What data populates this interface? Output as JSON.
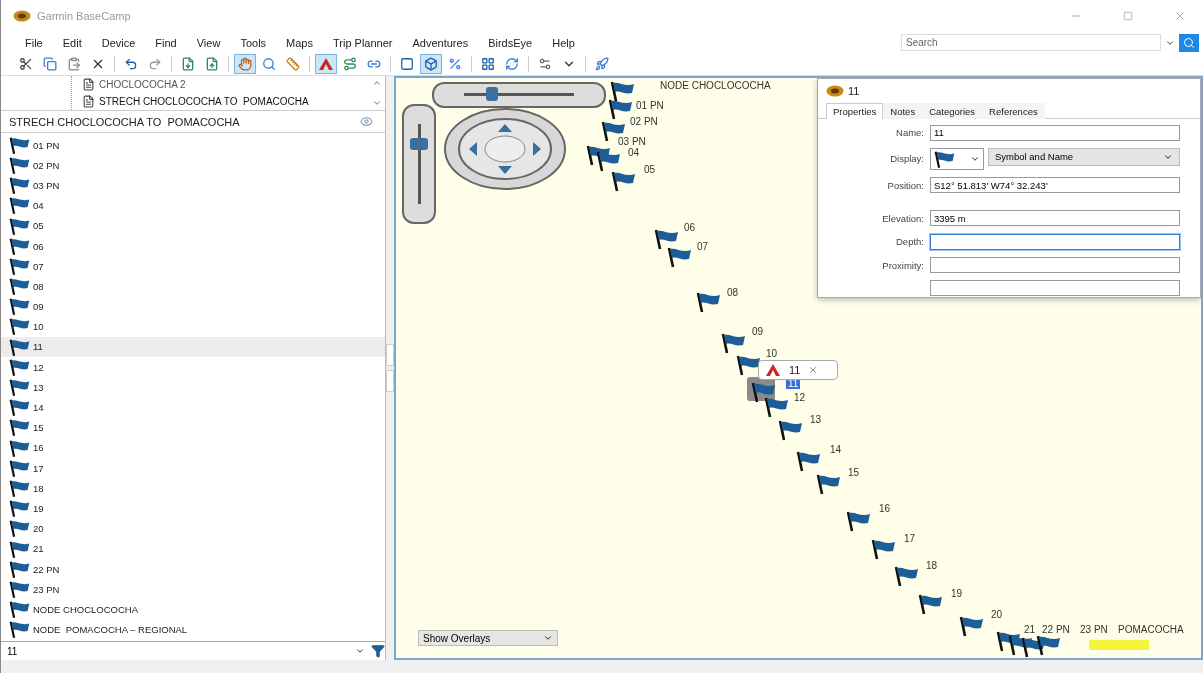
{
  "window": {
    "title": "Garmin BaseCamp"
  },
  "menu": [
    "File",
    "Edit",
    "Device",
    "Find",
    "View",
    "Tools",
    "Maps",
    "Trip Planner",
    "Adventures",
    "BirdsEye",
    "Help"
  ],
  "search": {
    "placeholder": "Search"
  },
  "toolbar": [
    {
      "selected": false
    },
    {
      "selected": false
    },
    {
      "selected": false
    },
    {
      "selected": false
    },
    {
      "selected": false
    },
    {
      "selected": false
    },
    {
      "selected": false
    },
    {
      "selected": false
    },
    {
      "selected": true
    },
    {
      "selected": false
    },
    {
      "selected": false
    },
    {
      "selected": true
    },
    {
      "selected": false
    },
    {
      "selected": false
    },
    {
      "selected": false
    },
    {
      "selected": true
    },
    {
      "selected": false
    },
    {
      "selected": false
    },
    {
      "selected": false
    },
    {
      "selected": false
    },
    {
      "selected": false
    },
    {
      "selected": false
    }
  ],
  "library_tree": [
    {
      "label": "CHOCLOCOCHA 2",
      "selected": false
    },
    {
      "label": "STRECH CHOCLOCOCHA TO  POMACOCHA",
      "selected": false
    }
  ],
  "list_header": "STRECH CHOCLOCOCHA TO  POMACOCHA",
  "waypoints": [
    {
      "name": "01 PN",
      "selected": false
    },
    {
      "name": "02 PN",
      "selected": false
    },
    {
      "name": "03 PN",
      "selected": false
    },
    {
      "name": "04",
      "selected": false
    },
    {
      "name": "05",
      "selected": false
    },
    {
      "name": "06",
      "selected": false
    },
    {
      "name": "07",
      "selected": false
    },
    {
      "name": "08",
      "selected": false
    },
    {
      "name": "09",
      "selected": false
    },
    {
      "name": "10",
      "selected": false
    },
    {
      "name": "11",
      "selected": true
    },
    {
      "name": "12",
      "selected": false
    },
    {
      "name": "13",
      "selected": false
    },
    {
      "name": "14",
      "selected": false
    },
    {
      "name": "15",
      "selected": false
    },
    {
      "name": "16",
      "selected": false
    },
    {
      "name": "17",
      "selected": false
    },
    {
      "name": "18",
      "selected": false
    },
    {
      "name": "19",
      "selected": false
    },
    {
      "name": "20",
      "selected": false
    },
    {
      "name": "21",
      "selected": false
    },
    {
      "name": "22 PN",
      "selected": false
    },
    {
      "name": "23 PN",
      "selected": false
    },
    {
      "name": "NODE CHOCLOCOCHA",
      "selected": false
    },
    {
      "name": "NODE  POMACOCHA – REGIONAL",
      "selected": false
    }
  ],
  "filter": {
    "value": "11"
  },
  "map": {
    "tilt_slider": {
      "level": 0.25
    },
    "overlay_select": "Show Overlays",
    "markers": [
      {
        "label": "01 PN",
        "selected": false
      },
      {
        "label": "NODE CHOCLOCOCHA",
        "selected": false
      },
      {
        "label": "02 PN",
        "selected": false
      },
      {
        "label": "03 PN",
        "selected": false
      },
      {
        "label": "04",
        "selected": false
      },
      {
        "label": "05",
        "selected": false
      },
      {
        "label": "06",
        "selected": false
      },
      {
        "label": "07",
        "selected": false
      },
      {
        "label": "08",
        "selected": false
      },
      {
        "label": "09",
        "selected": false
      },
      {
        "label": "10",
        "selected": false
      },
      {
        "label": "11",
        "selected": true
      },
      {
        "label": "12",
        "selected": false
      },
      {
        "label": "13",
        "selected": false
      },
      {
        "label": "14",
        "selected": false
      },
      {
        "label": "15",
        "selected": false
      },
      {
        "label": "16",
        "selected": false
      },
      {
        "label": "17",
        "selected": false
      },
      {
        "label": "18",
        "selected": false
      },
      {
        "label": "19",
        "selected": false
      },
      {
        "label": "20",
        "selected": false
      },
      {
        "label": "21",
        "selected": false
      },
      {
        "label": "22 PN",
        "selected": false
      },
      {
        "label": "23 PN",
        "selected": false
      },
      {
        "label": "POMACOCHA",
        "selected": false
      }
    ],
    "popup": {
      "title": "11"
    }
  },
  "properties": {
    "title": "11",
    "tabs": [
      {
        "label": "Properties",
        "selected": true
      },
      {
        "label": "Notes",
        "selected": false
      },
      {
        "label": "Categories",
        "selected": false
      },
      {
        "label": "References",
        "selected": false
      }
    ],
    "fields": [
      {
        "label": "Name:",
        "kind": "text",
        "value": "11",
        "focused": false
      },
      {
        "label": "Display:",
        "kind": "symbol",
        "value": "Symbol and Name"
      },
      {
        "label": "Position:",
        "kind": "text",
        "value": "S12° 51.813' W74° 32.243'",
        "focused": false
      },
      {
        "label": "Elevation:",
        "kind": "text",
        "value": "3395 m",
        "focused": false
      },
      {
        "label": "Depth:",
        "kind": "text",
        "focused": true
      },
      {
        "label": "Proximity:",
        "kind": "text",
        "focused": false
      },
      {
        "kind": "text",
        "focused": false
      }
    ]
  }
}
